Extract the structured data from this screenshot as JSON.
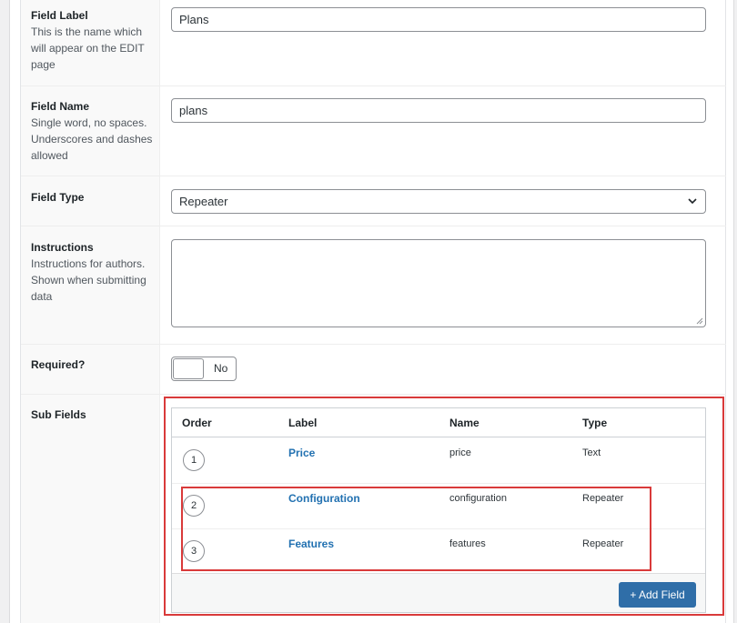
{
  "fields": {
    "label": {
      "title": "Field Label",
      "desc": "This is the name which will appear on the EDIT page",
      "value": "Plans"
    },
    "name": {
      "title": "Field Name",
      "desc": "Single word, no spaces. Underscores and dashes allowed",
      "value": "plans"
    },
    "type": {
      "title": "Field Type",
      "value": "Repeater"
    },
    "instructions": {
      "title": "Instructions",
      "desc": "Instructions for authors. Shown when submitting data",
      "value": ""
    },
    "required": {
      "title": "Required?",
      "toggle_text": "No"
    },
    "subfields": {
      "title": "Sub Fields"
    }
  },
  "subfields_table": {
    "headers": {
      "order": "Order",
      "label": "Label",
      "name": "Name",
      "type": "Type"
    },
    "rows": [
      {
        "order": "1",
        "label": "Price",
        "name": "price",
        "type": "Text"
      },
      {
        "order": "2",
        "label": "Configuration",
        "name": "configuration",
        "type": "Repeater"
      },
      {
        "order": "3",
        "label": "Features",
        "name": "features",
        "type": "Repeater"
      }
    ],
    "add_button": "+ Add Field"
  },
  "colors": {
    "link": "#2271b1",
    "button": "#2f6ea8",
    "highlight": "#d93a3a"
  }
}
